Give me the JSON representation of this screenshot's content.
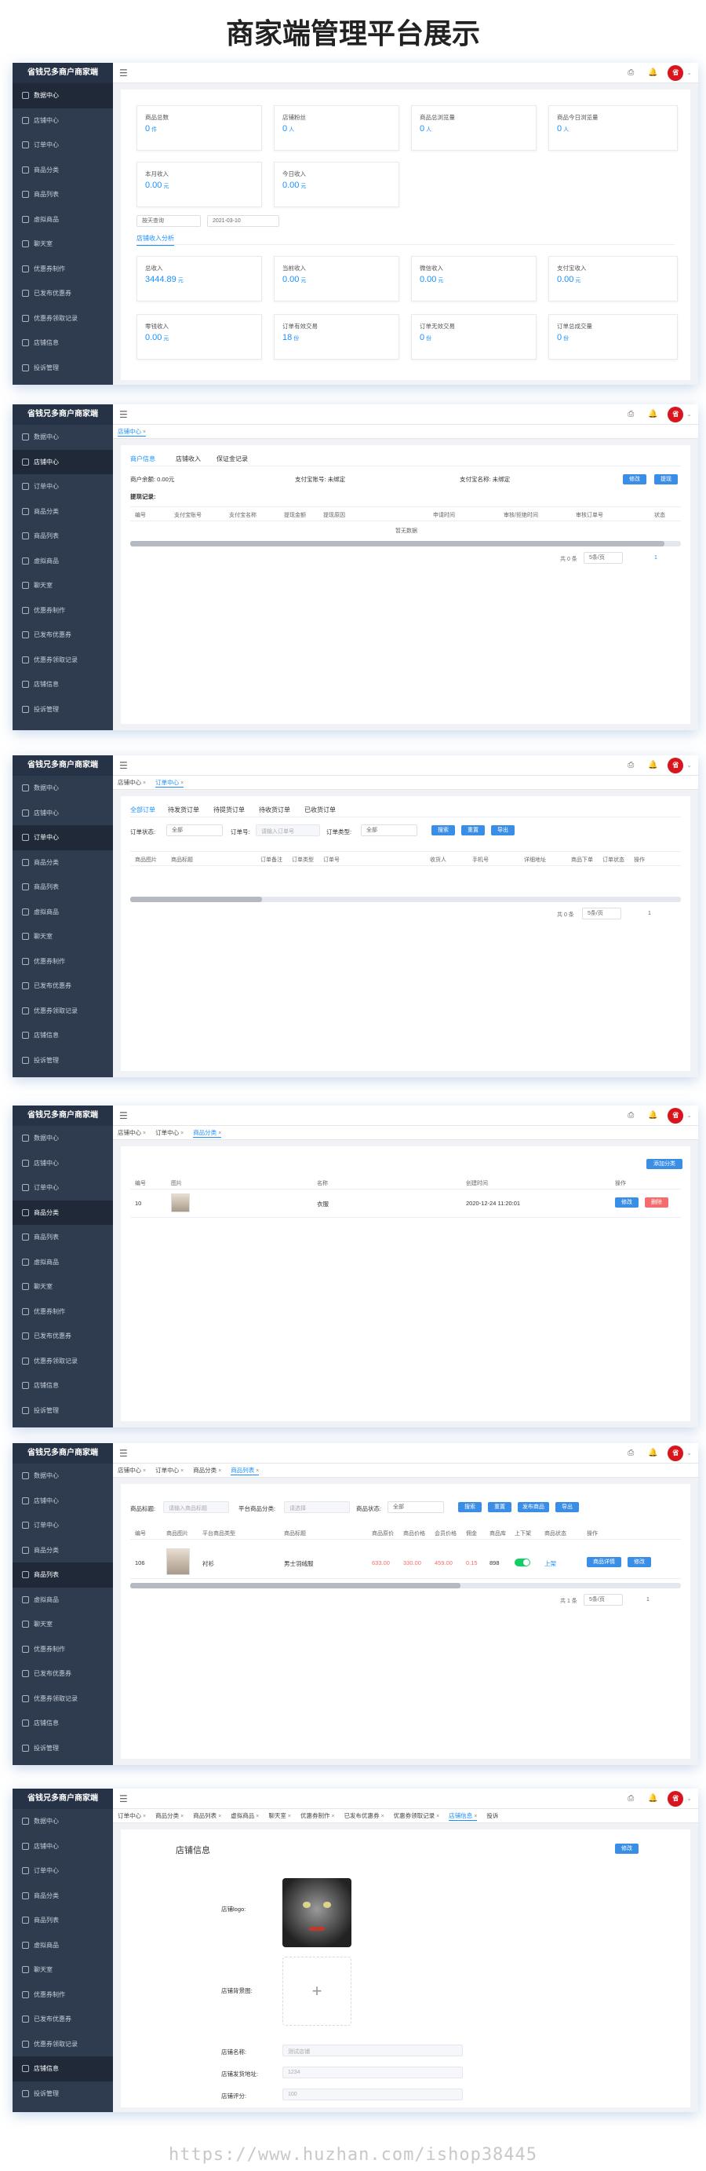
{
  "page_title": "商家端管理平台展示",
  "watermark": "https://www.huzhan.com/ishop38445",
  "app": {
    "logo": "省钱兄多商户商家端",
    "avatar_text": "省"
  },
  "sidebar": [
    "数据中心",
    "店铺中心",
    "订单中心",
    "商品分类",
    "商品列表",
    "虚拟商品",
    "聊天室",
    "优惠券制作",
    "已发布优惠券",
    "优惠券领取记录",
    "店铺信息",
    "投诉管理"
  ],
  "s1": {
    "cards": [
      {
        "label": "商品总数",
        "value": "0",
        "unit": "件"
      },
      {
        "label": "店铺粉丝",
        "value": "0",
        "unit": "人"
      },
      {
        "label": "商品总浏览量",
        "value": "0",
        "unit": "人"
      },
      {
        "label": "商品今日浏览量",
        "value": "0",
        "unit": "人"
      },
      {
        "label": "本月收入",
        "value": "0.00",
        "unit": "元"
      },
      {
        "label": "今日收入",
        "value": "0.00",
        "unit": "元"
      }
    ],
    "filter_select": "按天查询",
    "filter_date": "2021-03-10",
    "sub_tab": "店铺收入分析",
    "cards2": [
      {
        "label": "总收入",
        "value": "3444.89",
        "unit": "元"
      },
      {
        "label": "当前收入",
        "value": "0.00",
        "unit": "元"
      },
      {
        "label": "微信收入",
        "value": "0.00",
        "unit": "元"
      },
      {
        "label": "支付宝收入",
        "value": "0.00",
        "unit": "元"
      },
      {
        "label": "零钱收入",
        "value": "0.00",
        "unit": "元"
      },
      {
        "label": "订单有效交易",
        "value": "18",
        "unit": "份"
      },
      {
        "label": "订单无效交易",
        "value": "0",
        "unit": "份"
      },
      {
        "label": "订单总成交量",
        "value": "0",
        "unit": "份"
      }
    ]
  },
  "s2": {
    "tabs": [
      "店铺中心"
    ],
    "inner_tabs": [
      "商户信息",
      "店铺收入",
      "保证金记录"
    ],
    "balance": "商户余额: 0.00元",
    "alipay_account": "支付宝账号: 未绑定",
    "alipay_name": "支付宝名称: 未绑定",
    "btn_edit": "修改",
    "btn_withdraw": "提现",
    "record_title": "提现记录:",
    "columns": [
      "编号",
      "支付宝账号",
      "支付宝名称",
      "提现金额",
      "提现原因",
      "申请时间",
      "审核/拒绝时间",
      "审核订单号",
      "状态"
    ],
    "empty": "暂无数据",
    "total": "共 0 条",
    "per_page": "5条/页",
    "page": "1"
  },
  "s3": {
    "tabs": [
      "店铺中心",
      "订单中心"
    ],
    "inner_tabs": [
      "全部订单",
      "待发货订单",
      "待提货订单",
      "待收货订单",
      "已收货订单"
    ],
    "f_status_label": "订单状态:",
    "f_status_value": "全部",
    "f_no_label": "订单号:",
    "f_no_placeholder": "请输入订单号",
    "f_type_label": "订单类型:",
    "f_type_value": "全部",
    "btn_search": "搜索",
    "btn_reset": "重置",
    "btn_export": "导出",
    "columns": [
      "商品图片",
      "商品标题",
      "订单备注",
      "订单类型",
      "订单号",
      "收货人",
      "手机号",
      "详细地址",
      "商品下单",
      "订单状态",
      "操作"
    ],
    "total": "共 0 条",
    "per_page": "5条/页",
    "page": "1"
  },
  "s4": {
    "tabs": [
      "店铺中心",
      "订单中心",
      "商品分类"
    ],
    "btn_add": "添加分类",
    "columns": [
      "编号",
      "图片",
      "名称",
      "创建时间",
      "操作"
    ],
    "row": {
      "id": "10",
      "name": "衣服",
      "time": "2020-12-24 11:20:01",
      "edit": "修改",
      "del": "删除"
    }
  },
  "s5": {
    "tabs": [
      "店铺中心",
      "订单中心",
      "商品分类",
      "商品列表"
    ],
    "f_title_label": "商品标题:",
    "f_title_placeholder": "请输入商品标题",
    "f_cat_label": "平台商品分类:",
    "f_cat_placeholder": "请选择",
    "f_status_label": "商品状态:",
    "f_status_value": "全部",
    "btn_search": "搜索",
    "btn_reset": "重置",
    "btn_publish": "发布商品",
    "btn_export": "导出",
    "columns": [
      "编号",
      "商品图片",
      "平台商品类型",
      "商品标题",
      "商品原价",
      "商品价格",
      "会员价格",
      "佣金",
      "商品库",
      "上下架",
      "商品状态",
      "操作"
    ],
    "row": {
      "id": "106",
      "type": "衬衫",
      "title": "男士羽绒服",
      "orig": "633.00",
      "price": "330.00",
      "vip": "459.00",
      "comm": "0.15",
      "stock": "898",
      "status": "上架",
      "edit": "商品详情",
      "more": "修改"
    },
    "total": "共 1 条",
    "per_page": "5条/页",
    "page": "1"
  },
  "s6": {
    "tabs": [
      "订单中心",
      "商品分类",
      "商品列表",
      "虚拟商品",
      "聊天室",
      "优惠券制作",
      "已发布优惠券",
      "优惠券领取记录",
      "店铺信息",
      "投诉"
    ],
    "title": "店铺信息",
    "btn_edit": "修改",
    "logo_label": "店铺logo:",
    "bg_label": "店铺背景图:",
    "name_label": "店铺名称:",
    "name_value": "测试店铺",
    "addr_label": "店铺发货地址:",
    "addr_value": "1234",
    "score_label": "店铺评分:",
    "score_value": "100"
  }
}
